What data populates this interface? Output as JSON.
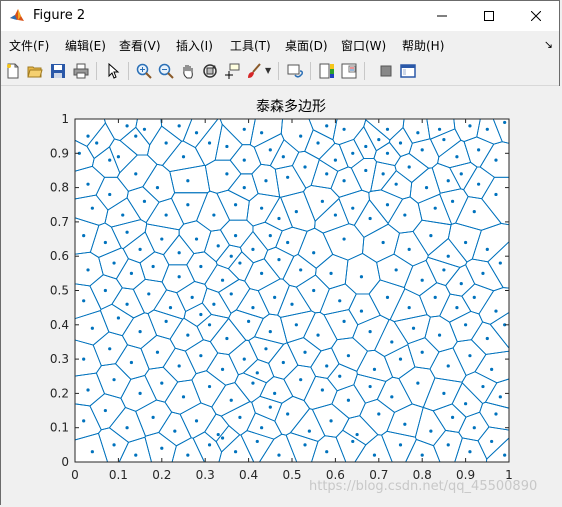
{
  "window": {
    "title": "Figure 2"
  },
  "menu": [
    {
      "label": "文件(F)"
    },
    {
      "label": "编辑(E)"
    },
    {
      "label": "查看(V)"
    },
    {
      "label": "插入(I)"
    },
    {
      "label": "工具(T)"
    },
    {
      "label": "桌面(D)"
    },
    {
      "label": "窗口(W)"
    },
    {
      "label": "帮助(H)"
    }
  ],
  "menu_overflow_glyph": "↘",
  "colors": {
    "voronoi": "#0072bd",
    "axes_bg": "#ffffff",
    "figure_bg": "#f0f0f0"
  },
  "toolbar": [
    "new-figure-icon",
    "open-file-icon",
    "save-icon",
    "print-icon",
    "pointer-icon",
    "zoom-in-icon",
    "zoom-out-icon",
    "pan-icon",
    "rotate-3d-icon",
    "data-cursor-icon",
    "brush-icon",
    "link-plot-icon",
    "colorbar-icon",
    "legend-icon",
    "hide-plot-tools-icon",
    "show-plot-tools-icon"
  ],
  "watermark": "https://blog.csdn.net/qq_45500890",
  "chart_data": {
    "type": "scatter",
    "title": "泰森多边形",
    "xlabel": "",
    "ylabel": "",
    "xlim": [
      0,
      1
    ],
    "ylim": [
      0,
      1
    ],
    "xticks": [
      "0",
      "0.1",
      "0.2",
      "0.3",
      "0.4",
      "0.5",
      "0.6",
      "0.7",
      "0.8",
      "0.9",
      "1"
    ],
    "yticks": [
      "0",
      "0.1",
      "0.2",
      "0.3",
      "0.4",
      "0.5",
      "0.6",
      "0.7",
      "0.8",
      "0.9",
      "1"
    ],
    "grid": false,
    "overlay": "voronoi diagram of the points",
    "points": [
      [
        0.01,
        0.9
      ],
      [
        0.03,
        0.95
      ],
      [
        0.05,
        0.93
      ],
      [
        0.08,
        0.88
      ],
      [
        0.12,
        0.98
      ],
      [
        0.16,
        0.97
      ],
      [
        0.24,
        0.98
      ],
      [
        0.28,
        0.96
      ],
      [
        0.39,
        0.97
      ],
      [
        0.43,
        0.96
      ],
      [
        0.52,
        0.95
      ],
      [
        0.58,
        0.98
      ],
      [
        0.62,
        0.97
      ],
      [
        0.72,
        0.97
      ],
      [
        0.79,
        0.96
      ],
      [
        0.84,
        0.97
      ],
      [
        0.91,
        0.98
      ],
      [
        0.95,
        0.97
      ],
      [
        0.99,
        0.99
      ],
      [
        0.7,
        0.94
      ],
      [
        0.1,
        0.89
      ],
      [
        0.14,
        0.95
      ],
      [
        0.21,
        0.93
      ],
      [
        0.25,
        0.89
      ],
      [
        0.31,
        0.93
      ],
      [
        0.35,
        0.92
      ],
      [
        0.39,
        0.88
      ],
      [
        0.45,
        0.91
      ],
      [
        0.48,
        0.89
      ],
      [
        0.56,
        0.93
      ],
      [
        0.6,
        0.88
      ],
      [
        0.64,
        0.9
      ],
      [
        0.67,
        0.92
      ],
      [
        0.72,
        0.9
      ],
      [
        0.75,
        0.93
      ],
      [
        0.8,
        0.91
      ],
      [
        0.85,
        0.94
      ],
      [
        0.88,
        0.89
      ],
      [
        0.93,
        0.91
      ],
      [
        0.97,
        0.88
      ],
      [
        0.03,
        0.81
      ],
      [
        0.08,
        0.78
      ],
      [
        0.14,
        0.84
      ],
      [
        0.19,
        0.8
      ],
      [
        0.26,
        0.82
      ],
      [
        0.35,
        0.84
      ],
      [
        0.39,
        0.8
      ],
      [
        0.44,
        0.82
      ],
      [
        0.49,
        0.83
      ],
      [
        0.53,
        0.86
      ],
      [
        0.58,
        0.84
      ],
      [
        0.62,
        0.82
      ],
      [
        0.67,
        0.85
      ],
      [
        0.71,
        0.84
      ],
      [
        0.74,
        0.81
      ],
      [
        0.77,
        0.86
      ],
      [
        0.81,
        0.8
      ],
      [
        0.86,
        0.82
      ],
      [
        0.89,
        0.84
      ],
      [
        0.93,
        0.81
      ],
      [
        0.04,
        0.74
      ],
      [
        0.11,
        0.72
      ],
      [
        0.16,
        0.76
      ],
      [
        0.21,
        0.72
      ],
      [
        0.26,
        0.75
      ],
      [
        0.32,
        0.72
      ],
      [
        0.37,
        0.75
      ],
      [
        0.43,
        0.74
      ],
      [
        0.47,
        0.71
      ],
      [
        0.51,
        0.73
      ],
      [
        0.57,
        0.76
      ],
      [
        0.6,
        0.72
      ],
      [
        0.64,
        0.74
      ],
      [
        0.68,
        0.71
      ],
      [
        0.72,
        0.75
      ],
      [
        0.76,
        0.72
      ],
      [
        0.83,
        0.74
      ],
      [
        0.87,
        0.76
      ],
      [
        0.92,
        0.73
      ],
      [
        0.97,
        0.78
      ],
      [
        0.02,
        0.66
      ],
      [
        0.07,
        0.64
      ],
      [
        0.12,
        0.67
      ],
      [
        0.15,
        0.62
      ],
      [
        0.2,
        0.65
      ],
      [
        0.24,
        0.61
      ],
      [
        0.28,
        0.65
      ],
      [
        0.33,
        0.63
      ],
      [
        0.37,
        0.66
      ],
      [
        0.41,
        0.62
      ],
      [
        0.45,
        0.66
      ],
      [
        0.49,
        0.64
      ],
      [
        0.55,
        0.61
      ],
      [
        0.62,
        0.65
      ],
      [
        0.71,
        0.64
      ],
      [
        0.77,
        0.62
      ],
      [
        0.82,
        0.66
      ],
      [
        0.86,
        0.6
      ],
      [
        0.9,
        0.64
      ],
      [
        0.95,
        0.62
      ],
      [
        0.03,
        0.56
      ],
      [
        0.09,
        0.58
      ],
      [
        0.13,
        0.55
      ],
      [
        0.18,
        0.57
      ],
      [
        0.24,
        0.54
      ],
      [
        0.29,
        0.57
      ],
      [
        0.34,
        0.53
      ],
      [
        0.38,
        0.58
      ],
      [
        0.43,
        0.55
      ],
      [
        0.47,
        0.59
      ],
      [
        0.52,
        0.56
      ],
      [
        0.59,
        0.55
      ],
      [
        0.66,
        0.54
      ],
      [
        0.74,
        0.56
      ],
      [
        0.8,
        0.53
      ],
      [
        0.85,
        0.56
      ],
      [
        0.89,
        0.52
      ],
      [
        0.94,
        0.55
      ],
      [
        0.98,
        0.58
      ],
      [
        0.36,
        0.6
      ],
      [
        0.02,
        0.47
      ],
      [
        0.07,
        0.5
      ],
      [
        0.12,
        0.46
      ],
      [
        0.17,
        0.49
      ],
      [
        0.22,
        0.45
      ],
      [
        0.27,
        0.48
      ],
      [
        0.32,
        0.46
      ],
      [
        0.36,
        0.49
      ],
      [
        0.41,
        0.45
      ],
      [
        0.46,
        0.48
      ],
      [
        0.5,
        0.46
      ],
      [
        0.55,
        0.5
      ],
      [
        0.61,
        0.47
      ],
      [
        0.66,
        0.44
      ],
      [
        0.72,
        0.48
      ],
      [
        0.77,
        0.45
      ],
      [
        0.83,
        0.48
      ],
      [
        0.88,
        0.45
      ],
      [
        0.92,
        0.48
      ],
      [
        0.97,
        0.44
      ],
      [
        0.04,
        0.39
      ],
      [
        0.1,
        0.42
      ],
      [
        0.15,
        0.38
      ],
      [
        0.21,
        0.41
      ],
      [
        0.26,
        0.37
      ],
      [
        0.31,
        0.4
      ],
      [
        0.35,
        0.36
      ],
      [
        0.4,
        0.41
      ],
      [
        0.45,
        0.38
      ],
      [
        0.51,
        0.4
      ],
      [
        0.56,
        0.37
      ],
      [
        0.62,
        0.41
      ],
      [
        0.68,
        0.38
      ],
      [
        0.73,
        0.35
      ],
      [
        0.78,
        0.39
      ],
      [
        0.84,
        0.37
      ],
      [
        0.9,
        0.4
      ],
      [
        0.95,
        0.36
      ],
      [
        0.99,
        0.4
      ],
      [
        0.29,
        0.43
      ],
      [
        0.02,
        0.3
      ],
      [
        0.08,
        0.33
      ],
      [
        0.13,
        0.29
      ],
      [
        0.19,
        0.32
      ],
      [
        0.24,
        0.28
      ],
      [
        0.29,
        0.31
      ],
      [
        0.34,
        0.27
      ],
      [
        0.39,
        0.3
      ],
      [
        0.44,
        0.33
      ],
      [
        0.48,
        0.29
      ],
      [
        0.53,
        0.32
      ],
      [
        0.58,
        0.28
      ],
      [
        0.63,
        0.31
      ],
      [
        0.69,
        0.27
      ],
      [
        0.75,
        0.3
      ],
      [
        0.8,
        0.32
      ],
      [
        0.86,
        0.28
      ],
      [
        0.91,
        0.31
      ],
      [
        0.96,
        0.27
      ],
      [
        0.42,
        0.26
      ],
      [
        0.03,
        0.21
      ],
      [
        0.09,
        0.24
      ],
      [
        0.15,
        0.2
      ],
      [
        0.2,
        0.23
      ],
      [
        0.25,
        0.19
      ],
      [
        0.31,
        0.22
      ],
      [
        0.36,
        0.18
      ],
      [
        0.41,
        0.23
      ],
      [
        0.46,
        0.2
      ],
      [
        0.52,
        0.24
      ],
      [
        0.57,
        0.21
      ],
      [
        0.63,
        0.18
      ],
      [
        0.68,
        0.22
      ],
      [
        0.73,
        0.19
      ],
      [
        0.79,
        0.23
      ],
      [
        0.85,
        0.2
      ],
      [
        0.9,
        0.17
      ],
      [
        0.94,
        0.22
      ],
      [
        0.98,
        0.19
      ],
      [
        0.61,
        0.25
      ],
      [
        0.02,
        0.12
      ],
      [
        0.07,
        0.15
      ],
      [
        0.12,
        0.1
      ],
      [
        0.18,
        0.13
      ],
      [
        0.23,
        0.09
      ],
      [
        0.28,
        0.12
      ],
      [
        0.33,
        0.08
      ],
      [
        0.38,
        0.13
      ],
      [
        0.43,
        0.1
      ],
      [
        0.49,
        0.14
      ],
      [
        0.54,
        0.09
      ],
      [
        0.59,
        0.12
      ],
      [
        0.65,
        0.08
      ],
      [
        0.7,
        0.14
      ],
      [
        0.76,
        0.11
      ],
      [
        0.82,
        0.09
      ],
      [
        0.87,
        0.13
      ],
      [
        0.92,
        0.1
      ],
      [
        0.97,
        0.14
      ],
      [
        0.45,
        0.16
      ],
      [
        0.04,
        0.03
      ],
      [
        0.09,
        0.05
      ],
      [
        0.14,
        0.02
      ],
      [
        0.2,
        0.04
      ],
      [
        0.26,
        0.02
      ],
      [
        0.31,
        0.05
      ],
      [
        0.37,
        0.03
      ],
      [
        0.42,
        0.06
      ],
      [
        0.47,
        0.02
      ],
      [
        0.53,
        0.05
      ],
      [
        0.58,
        0.03
      ],
      [
        0.64,
        0.06
      ],
      [
        0.69,
        0.02
      ],
      [
        0.75,
        0.05
      ],
      [
        0.8,
        0.02
      ],
      [
        0.86,
        0.05
      ],
      [
        0.91,
        0.03
      ],
      [
        0.96,
        0.06
      ],
      [
        0.99,
        0.02
      ],
      [
        0.34,
        0.07
      ]
    ]
  }
}
